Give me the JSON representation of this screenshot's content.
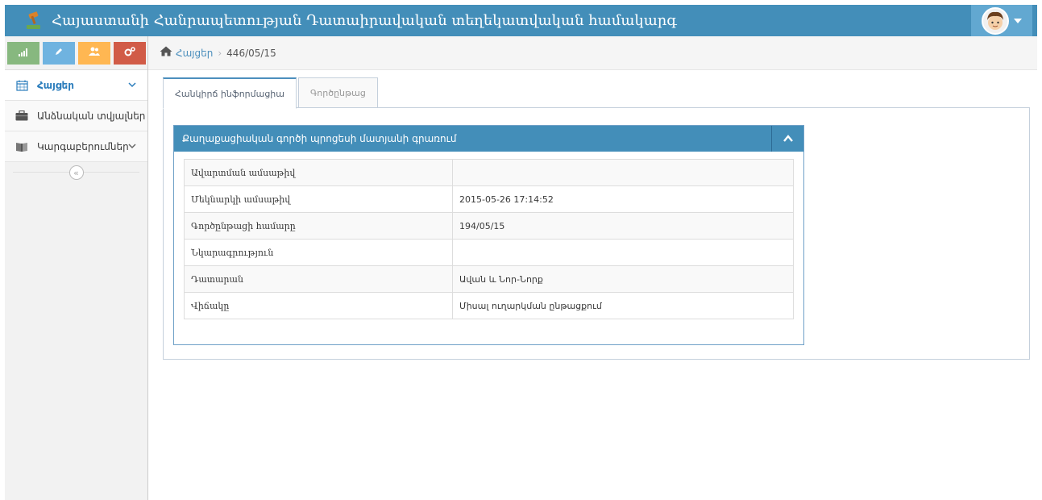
{
  "app": {
    "title": "Հայաստանի Հանրապետության Դատաիրավական տեղեկատվական համակարգ"
  },
  "sidebar": {
    "items": [
      {
        "label": "Հայցեր",
        "icon": "calendar-icon",
        "active": true
      },
      {
        "label": "Անձնական տվյալներ",
        "icon": "briefcase-icon",
        "active": false
      },
      {
        "label": "Կարգաբերումներ",
        "icon": "book-icon",
        "active": false
      }
    ]
  },
  "breadcrumb": {
    "link": "Հայցեր",
    "current": "446/05/15"
  },
  "tabs": [
    {
      "label": "Հանկիրճ ինֆորմացիա",
      "active": true
    },
    {
      "label": "Գործընթաց",
      "active": false
    }
  ],
  "panel": {
    "title": "Քաղաքացիական գործի պրոցեսի մատյանի գրառում",
    "rows": [
      {
        "label": "Ավարտման ամսաթիվ",
        "value": ""
      },
      {
        "label": "Մեկնարկի ամսաթիվ",
        "value": "2015-05-26 17:14:52"
      },
      {
        "label": "Գործընթացի համարը",
        "value": "194/05/15"
      },
      {
        "label": "Նկարագրություն",
        "value": ""
      },
      {
        "label": "Դատարան",
        "value": "Ավան և Նոր-Նորք"
      },
      {
        "label": "Վիճակը",
        "value": "Միսալ ուղարկման ընթացքում"
      }
    ]
  },
  "colors": {
    "navbar": "#438eb9",
    "accent": "#4c8fbd"
  }
}
